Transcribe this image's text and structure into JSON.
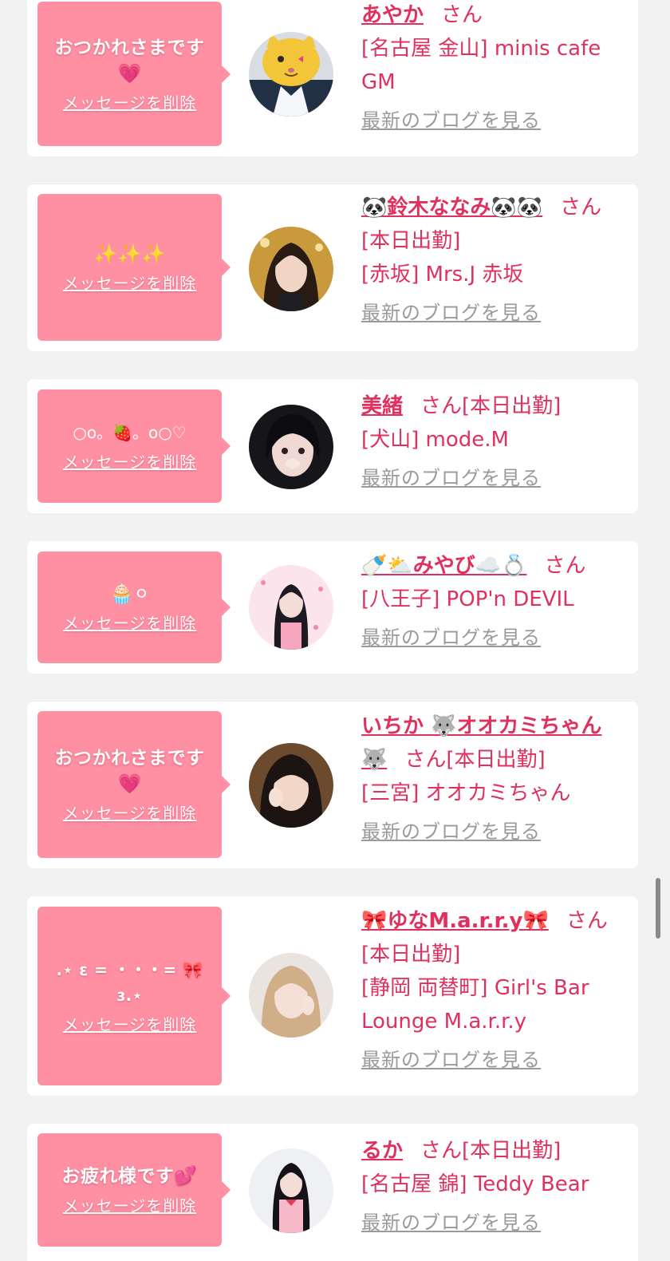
{
  "delete_label": "メッセージを削除",
  "blog_label": "最新のブログを見る",
  "san_label": "さん",
  "colors": {
    "bubble": "#ff8fa3",
    "accent_text": "#e0315e",
    "link_gray": "#9a9a9a",
    "card": "#ffffff",
    "background": "#f2f2f2"
  },
  "cards": [
    {
      "message": "おつかれさまです",
      "message_emoji": "💗",
      "name": "あやか",
      "lines": [
        "[名古屋 金山] minis cafe GM"
      ],
      "avatar": "cat-filter-photo"
    },
    {
      "message": "",
      "message_emoji": "✨✨✨",
      "name": "🐼鈴木ななみ🐼🐼",
      "lines": [
        "[本日出勤]",
        "[赤坂] Mrs.J 赤坂"
      ],
      "avatar": "woman-photo"
    },
    {
      "message": "",
      "message_emoji": "○o。🍓。o○♡",
      "name": "美緒",
      "name_suffix": "[本日出勤]",
      "lines": [
        "[犬山] mode.M"
      ],
      "avatar": "dark-hair-photo"
    },
    {
      "message": "",
      "message_emoji": "🧁⚪",
      "name": "🍼⛅みやび☁️💍",
      "lines": [
        "[八王子] POP'n DEVIL"
      ],
      "avatar": "pink-photo"
    },
    {
      "message": "おつかれさまです",
      "message_emoji": "💗",
      "name": "いちか 🐺オオカミちゃん 🐺",
      "name_suffix": "[本日出勤]",
      "lines": [
        "[三宮] オオカミちゃん"
      ],
      "avatar": "girl-photo"
    },
    {
      "message": ".⋆ ε = ・・・= 🎀 ɜ.⋆",
      "message_emoji": "",
      "name": "🎀ゆなM.a.r.r.y🎀",
      "lines": [
        "[本日出勤]",
        "[静岡 両替町] Girl's Bar Lounge M.a.r.r.y"
      ],
      "avatar": "blonde-photo"
    },
    {
      "message": "お疲れ様です💕",
      "message_emoji": "",
      "name": "るか",
      "name_suffix": "[本日出勤]",
      "lines": [
        "[名古屋 錦] Teddy Bear"
      ],
      "avatar": "idol-photo"
    }
  ]
}
